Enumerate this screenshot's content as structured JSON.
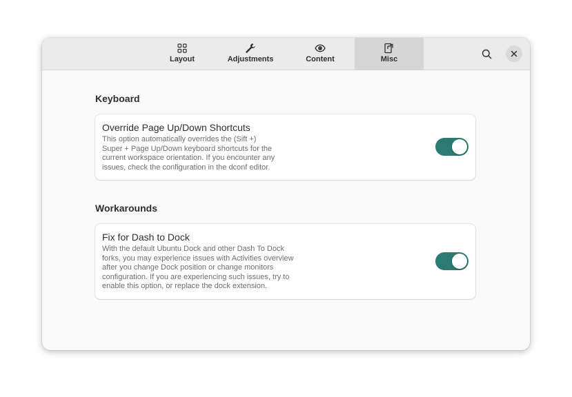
{
  "header": {
    "tabs": [
      {
        "label": "Layout",
        "icon": "grid-icon"
      },
      {
        "label": "Adjustments",
        "icon": "wrench-icon"
      },
      {
        "label": "Content",
        "icon": "eye-icon"
      },
      {
        "label": "Misc",
        "icon": "misc-icon",
        "active": true
      }
    ],
    "search_icon": "search-icon",
    "close_icon": "close-icon"
  },
  "sections": [
    {
      "title": "Keyboard",
      "rows": [
        {
          "title": "Override Page Up/Down Shortcuts",
          "subtitle": "This option automatically overrides the (Sift +)\nSuper + Page Up/Down keyboard shortcuts for the\ncurrent workspace orientation. If you encounter any\nissues, check the configuration in the dconf editor.",
          "enabled": true
        }
      ]
    },
    {
      "title": "Workarounds",
      "rows": [
        {
          "title": "Fix for Dash to Dock",
          "subtitle": "With the default Ubuntu Dock and other Dash To Dock\nforks, you may experience issues with Activities overview\nafter you change Dock position or change monitors\nconfiguration. If you are experiencing such issues, try to\nenable this option, or replace the dock extension.",
          "enabled": true
        }
      ]
    }
  ],
  "colors": {
    "accent": "#2c7a72",
    "header_bg": "#ebebeb",
    "active_tab_bg": "#d6d6d6",
    "window_bg": "#fafafa"
  }
}
